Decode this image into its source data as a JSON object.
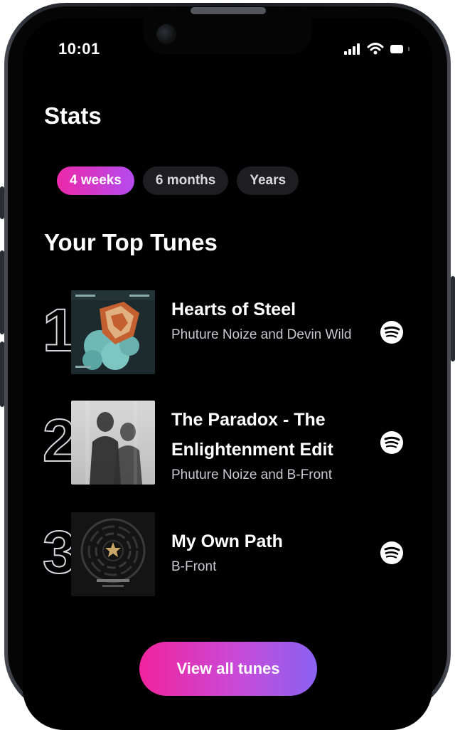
{
  "status_bar": {
    "time": "10:01"
  },
  "header": {
    "title": "Stats"
  },
  "filters": [
    {
      "label": "4 weeks",
      "active": true
    },
    {
      "label": "6 months",
      "active": false
    },
    {
      "label": "Years",
      "active": false
    }
  ],
  "section": {
    "title": "Your Top Tunes"
  },
  "tunes": [
    {
      "rank": "1",
      "title": "Hearts of Steel",
      "artist": "Phuture Noize and Devin Wild",
      "icon": "spotify-icon"
    },
    {
      "rank": "2",
      "title": "The Paradox - The Enlightenment Edit",
      "artist": "Phuture Noize and B-Front",
      "icon": "spotify-icon"
    },
    {
      "rank": "3",
      "title": "My Own Path",
      "artist": "B-Front",
      "icon": "spotify-icon"
    }
  ],
  "cta": {
    "label": "View all tunes"
  },
  "colors": {
    "accent_start": "#ec29a8",
    "accent_end": "#8a63f2",
    "background": "#000000"
  }
}
